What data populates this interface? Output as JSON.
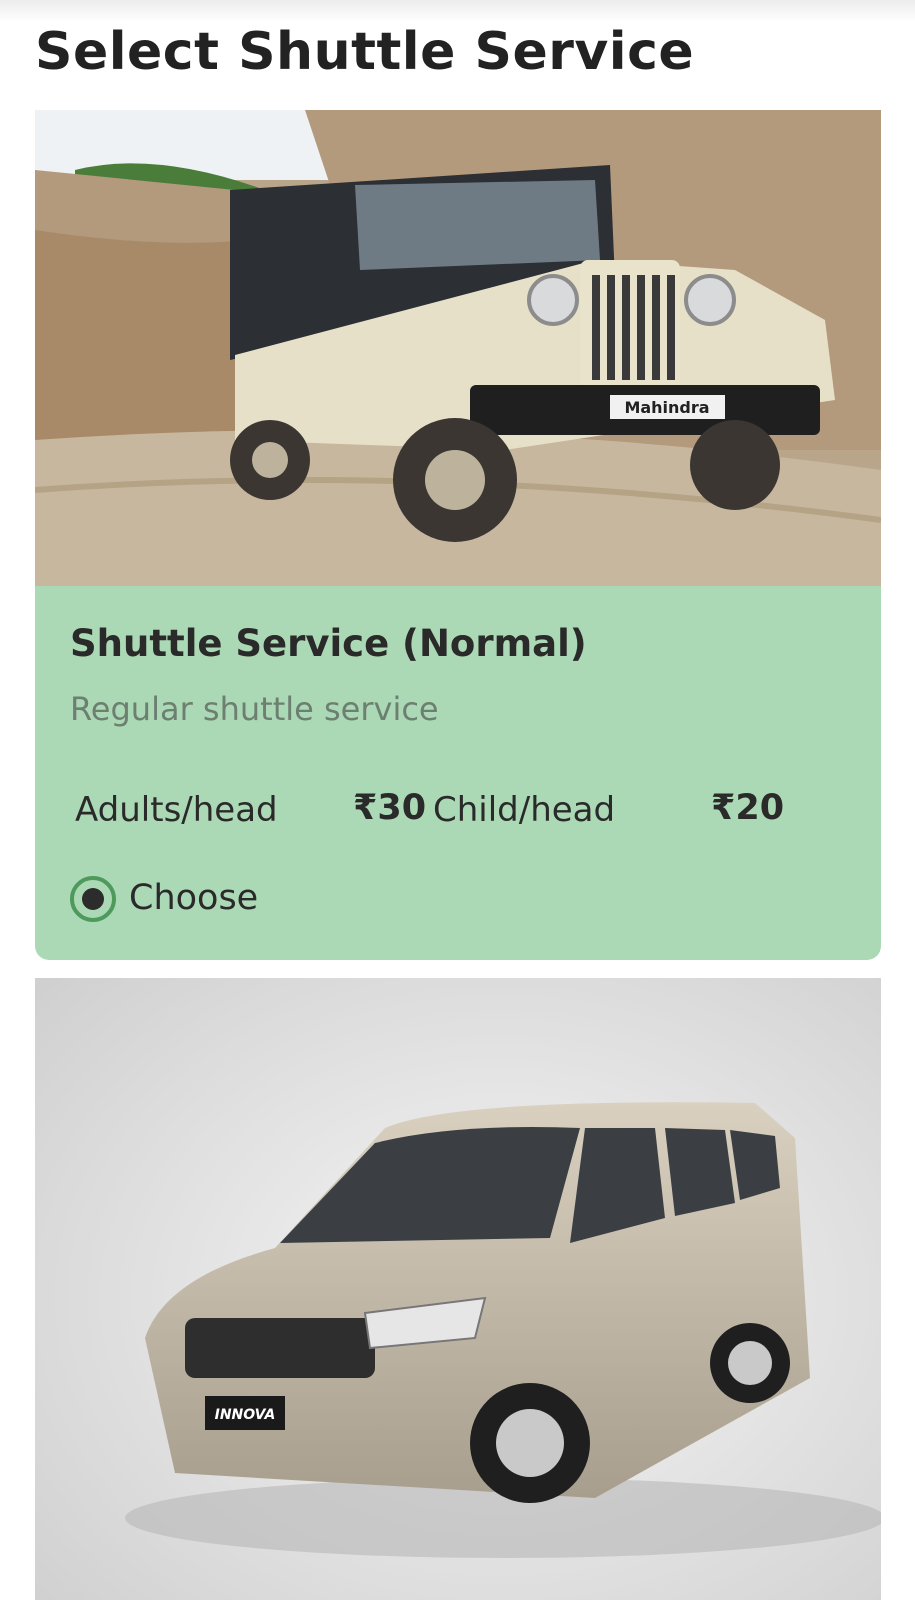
{
  "page": {
    "title": "Select Shuttle Service"
  },
  "services": [
    {
      "name": "Shuttle Service (Normal)",
      "description": "Regular shuttle service",
      "adult_label": "Adults/head",
      "adult_price": "₹30",
      "child_label": "Child/head",
      "child_price": "₹20",
      "choose_label": "Choose",
      "selected": true,
      "image_icon": "jeep-photo"
    },
    {
      "image_icon": "minivan-photo"
    }
  ],
  "colors": {
    "card_bg": "#acd9b5",
    "radio_ring": "#4e9a5c",
    "radio_dot": "#2c2c2c",
    "description_text": "#6c7f70"
  }
}
